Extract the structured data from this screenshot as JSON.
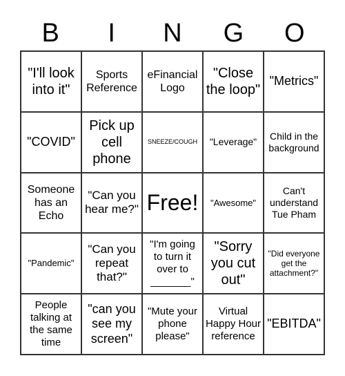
{
  "header": [
    "B",
    "I",
    "N",
    "G",
    "O"
  ],
  "cells": [
    {
      "text": "\"I'll look into it\"",
      "size": 20
    },
    {
      "text": "Sports Reference",
      "size": 16
    },
    {
      "text": "eFinancial Logo",
      "size": 16
    },
    {
      "text": "\"Close the loop\"",
      "size": 20
    },
    {
      "text": "\"Metrics\"",
      "size": 18
    },
    {
      "text": "\"COVID\"",
      "size": 18
    },
    {
      "text": "Pick up cell phone",
      "size": 20
    },
    {
      "text": "SNEEZE/COUGH",
      "size": 9
    },
    {
      "text": "\"Leverage\"",
      "size": 14
    },
    {
      "text": "Child in the background",
      "size": 14
    },
    {
      "text": "Someone has an Echo",
      "size": 16
    },
    {
      "text": "\"Can you hear me?\"",
      "size": 17
    },
    {
      "text": "Free!",
      "size": 32
    },
    {
      "text": "\"Awesome\"",
      "size": 13
    },
    {
      "text": "Can't understand Tue Pham",
      "size": 14
    },
    {
      "text": "\"Pandemic\"",
      "size": 13
    },
    {
      "text": "\"Can you repeat that?\"",
      "size": 17
    },
    {
      "text": "\"I'm going to turn it over to _______\"",
      "size": 15
    },
    {
      "text": "\"Sorry you cut out\"",
      "size": 20
    },
    {
      "text": "\"Did everyone get the attachment?\"",
      "size": 12
    },
    {
      "text": "People talking at the same time",
      "size": 15
    },
    {
      "text": "\"can you see my screen\"",
      "size": 18
    },
    {
      "text": "\"Mute your phone please\"",
      "size": 15
    },
    {
      "text": "Virtual Happy Hour reference",
      "size": 15
    },
    {
      "text": "\"EBITDA\"",
      "size": 18
    }
  ]
}
